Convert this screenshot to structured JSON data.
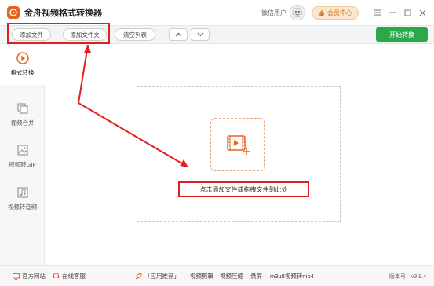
{
  "app": {
    "title": "金舟视频格式转换器",
    "wechat_user": "微信用户",
    "vip_label": "会员中心",
    "accent_color": "#e8621f",
    "green_color": "#2ba84a",
    "highlight_color": "#e02020"
  },
  "window_controls": {
    "menu_icon": "menu-icon",
    "minimize_icon": "minimize-icon",
    "maximize_icon": "maximize-icon",
    "close_icon": "close-icon"
  },
  "toolbar": {
    "add_file": "添加文件",
    "add_folder": "添加文件夹",
    "clear_list": "清空列表",
    "start": "开始转换"
  },
  "sidebar": {
    "items": [
      {
        "label": "格式转换",
        "icon": "play-circle-icon",
        "active": true
      },
      {
        "label": "视频合并",
        "icon": "merge-icon",
        "active": false
      },
      {
        "label": "视频转GIF",
        "icon": "gif-image-icon",
        "active": false
      },
      {
        "label": "视频转音频",
        "icon": "music-note-icon",
        "active": false
      }
    ]
  },
  "main": {
    "drop_hint": "点击添加文件或拖拽文件到此处",
    "drop_icon": "add-video-icon"
  },
  "footer": {
    "website": "官方网站",
    "support": "在线客服",
    "recommend": "「应用推荐」",
    "links": [
      "视频剪辑",
      "视频压缩",
      "录屏",
      "m3u8视频转mp4"
    ],
    "version": "版本号：v3.9.4"
  }
}
